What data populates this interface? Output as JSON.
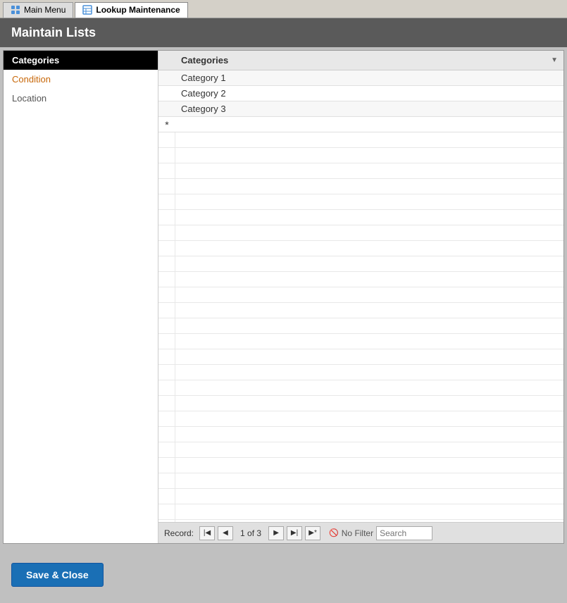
{
  "tabs": [
    {
      "id": "main-menu",
      "label": "Main Menu",
      "active": false,
      "icon": "grid-icon"
    },
    {
      "id": "lookup-maintenance",
      "label": "Lookup Maintenance",
      "active": true,
      "icon": "table-icon"
    }
  ],
  "page_title": "Maintain Lists",
  "sidebar": {
    "items": [
      {
        "id": "categories",
        "label": "Categories",
        "active": true,
        "style": "active"
      },
      {
        "id": "condition",
        "label": "Condition",
        "active": false,
        "style": "condition"
      },
      {
        "id": "location",
        "label": "Location",
        "active": false,
        "style": "location"
      }
    ]
  },
  "table": {
    "column_header": "Categories",
    "sort_arrow": "▼",
    "rows": [
      {
        "id": 1,
        "value": "Category 1"
      },
      {
        "id": 2,
        "value": "Category 2"
      },
      {
        "id": 3,
        "value": "Category 3"
      }
    ],
    "new_row_marker": "*"
  },
  "navigation": {
    "record_label": "Record:",
    "first_btn": "◀◀",
    "prev_btn": "◀",
    "page_info": "1 of 3",
    "next_btn": "▶",
    "last_btn": "▶▶",
    "extra_btn": "▶|",
    "filter_icon": "🚫",
    "no_filter_label": "No Filter",
    "search_placeholder": "Search"
  },
  "bottom": {
    "save_close_label": "Save & Close"
  }
}
